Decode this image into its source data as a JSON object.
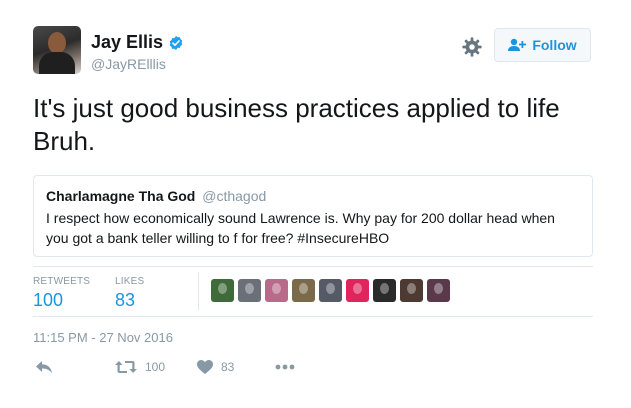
{
  "author": {
    "name": "Jay Ellis",
    "handle": "@JayRElllis",
    "verified": true
  },
  "follow_button": {
    "label": "Follow"
  },
  "tweet": {
    "text": "It's just good business practices applied to life Bruh."
  },
  "quoted_tweet": {
    "name": "Charlamagne Tha God",
    "handle": "@cthagod",
    "text": "I respect how economically sound Lawrence is. Why pay for 200 dollar head when you got a bank teller willing to f      for free? #InsecureHBO"
  },
  "stats": {
    "retweets_label": "RETWEETS",
    "retweets_value": "100",
    "likes_label": "LIKES",
    "likes_value": "83"
  },
  "liker_avatars": [
    {
      "name": "liker-1",
      "color": "#3f6b3a"
    },
    {
      "name": "liker-2",
      "color": "#6a6f78"
    },
    {
      "name": "liker-3",
      "color": "#b86a8a"
    },
    {
      "name": "liker-4",
      "color": "#7a6a4a"
    },
    {
      "name": "liker-5",
      "color": "#555a66"
    },
    {
      "name": "liker-6",
      "color": "#e0245e"
    },
    {
      "name": "liker-7",
      "color": "#2a2a2a"
    },
    {
      "name": "liker-8",
      "color": "#4d3a32"
    },
    {
      "name": "liker-9",
      "color": "#5a3a4a"
    }
  ],
  "timestamp": "11:15 PM - 27 Nov 2016",
  "actions": {
    "reply_icon": "reply-icon",
    "retweet_icon": "retweet-icon",
    "retweet_count": "100",
    "like_icon": "heart-icon",
    "like_count": "83",
    "more_icon": "more-icon"
  },
  "colors": {
    "accent": "#1b95e0",
    "muted": "#8899a6",
    "border": "#e1e8ed"
  }
}
